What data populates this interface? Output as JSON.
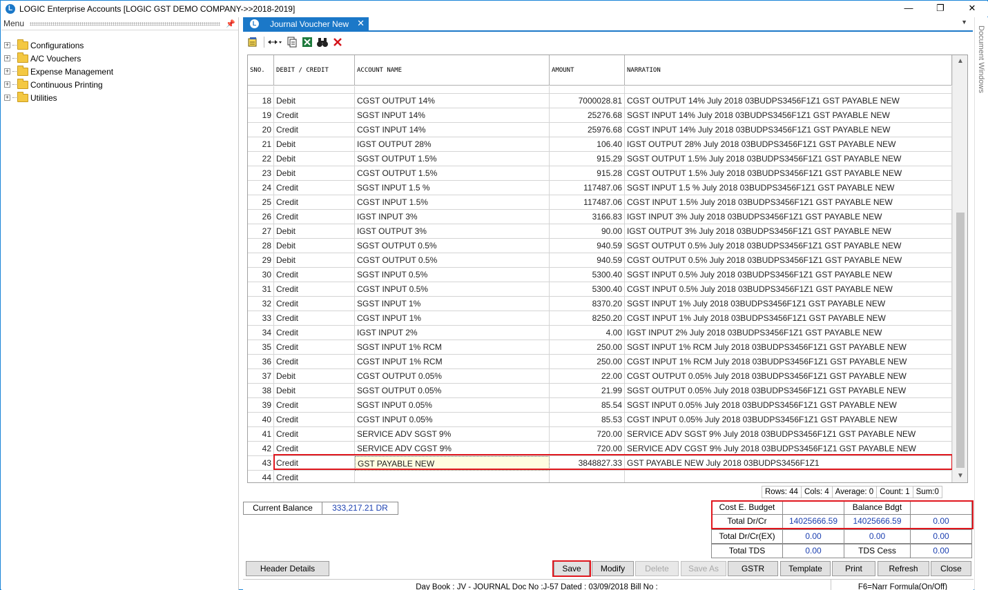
{
  "window": {
    "title": "LOGIC Enterprise Accounts  [LOGIC GST DEMO COMPANY->>2018-2019]",
    "minimize": "—",
    "restore": "❐",
    "close": "✕"
  },
  "menu": {
    "header": "Menu",
    "items": [
      {
        "label": "Configurations"
      },
      {
        "label": "A/C Vouchers"
      },
      {
        "label": "Expense Management"
      },
      {
        "label": "Continuous Printing"
      },
      {
        "label": "Utilities"
      }
    ]
  },
  "tab": {
    "label": "Journal Voucher New",
    "close": "✕"
  },
  "side_strip": "Document Windows",
  "grid": {
    "columns": [
      "SNO.",
      "DEBIT / CREDIT",
      "ACCOUNT NAME",
      "AMOUNT",
      "NARRATION"
    ],
    "rows": [
      {
        "sno": "18",
        "dc": "Debit",
        "account": "CGST OUTPUT 14%",
        "amount": "7000028.81",
        "narration": "CGST OUTPUT 14% July 2018 03BUDPS3456F1Z1 GST PAYABLE NEW"
      },
      {
        "sno": "19",
        "dc": "Credit",
        "account": "SGST INPUT 14%",
        "amount": "25276.68",
        "narration": "SGST INPUT  14% July 2018 03BUDPS3456F1Z1 GST PAYABLE NEW"
      },
      {
        "sno": "20",
        "dc": "Credit",
        "account": "CGST INPUT 14%",
        "amount": "25976.68",
        "narration": "CGST INPUT 14% July 2018 03BUDPS3456F1Z1 GST PAYABLE NEW"
      },
      {
        "sno": "21",
        "dc": "Debit",
        "account": "IGST OUTPUT 28%",
        "amount": "106.40",
        "narration": "IGST OUTPUT 28% July 2018 03BUDPS3456F1Z1 GST PAYABLE NEW"
      },
      {
        "sno": "22",
        "dc": "Debit",
        "account": "SGST OUTPUT 1.5%",
        "amount": "915.29",
        "narration": "SGST OUTPUT 1.5% July 2018 03BUDPS3456F1Z1 GST PAYABLE NEW"
      },
      {
        "sno": "23",
        "dc": "Debit",
        "account": "CGST OUTPUT 1.5%",
        "amount": "915.28",
        "narration": "CGST OUTPUT 1.5% July 2018 03BUDPS3456F1Z1 GST PAYABLE NEW"
      },
      {
        "sno": "24",
        "dc": "Credit",
        "account": "SGST INPUT 1.5 %",
        "amount": "117487.06",
        "narration": "SGST INPUT 1.5 % July 2018 03BUDPS3456F1Z1 GST PAYABLE NEW"
      },
      {
        "sno": "25",
        "dc": "Credit",
        "account": "CGST INPUT 1.5%",
        "amount": "117487.06",
        "narration": "CGST INPUT 1.5% July 2018 03BUDPS3456F1Z1 GST PAYABLE NEW"
      },
      {
        "sno": "26",
        "dc": "Credit",
        "account": "IGST INPUT 3%",
        "amount": "3166.83",
        "narration": "IGST INPUT 3% July 2018 03BUDPS3456F1Z1 GST PAYABLE NEW"
      },
      {
        "sno": "27",
        "dc": "Debit",
        "account": "IGST OUTPUT 3%",
        "amount": "90.00",
        "narration": "IGST OUTPUT 3% July 2018 03BUDPS3456F1Z1 GST PAYABLE NEW"
      },
      {
        "sno": "28",
        "dc": "Debit",
        "account": "SGST OUTPUT 0.5%",
        "amount": "940.59",
        "narration": "SGST OUTPUT 0.5% July 2018 03BUDPS3456F1Z1 GST PAYABLE NEW"
      },
      {
        "sno": "29",
        "dc": "Debit",
        "account": "CGST OUTPUT 0.5%",
        "amount": "940.59",
        "narration": "CGST OUTPUT 0.5% July 2018 03BUDPS3456F1Z1 GST PAYABLE NEW"
      },
      {
        "sno": "30",
        "dc": "Credit",
        "account": "SGST INPUT 0.5%",
        "amount": "5300.40",
        "narration": "SGST INPUT 0.5% July 2018 03BUDPS3456F1Z1 GST PAYABLE NEW"
      },
      {
        "sno": "31",
        "dc": "Credit",
        "account": "CGST INPUT 0.5%",
        "amount": "5300.40",
        "narration": "CGST INPUT 0.5% July 2018 03BUDPS3456F1Z1 GST PAYABLE NEW"
      },
      {
        "sno": "32",
        "dc": "Credit",
        "account": "SGST INPUT 1%",
        "amount": "8370.20",
        "narration": "SGST INPUT 1% July 2018 03BUDPS3456F1Z1 GST PAYABLE NEW"
      },
      {
        "sno": "33",
        "dc": "Credit",
        "account": "CGST INPUT 1%",
        "amount": "8250.20",
        "narration": "CGST INPUT 1% July 2018 03BUDPS3456F1Z1 GST PAYABLE NEW"
      },
      {
        "sno": "34",
        "dc": "Credit",
        "account": "IGST INPUT 2%",
        "amount": "4.00",
        "narration": "IGST INPUT 2% July 2018 03BUDPS3456F1Z1 GST PAYABLE NEW"
      },
      {
        "sno": "35",
        "dc": "Credit",
        "account": "SGST INPUT 1% RCM",
        "amount": "250.00",
        "narration": "SGST INPUT 1% RCM July 2018 03BUDPS3456F1Z1 GST PAYABLE NEW"
      },
      {
        "sno": "36",
        "dc": "Credit",
        "account": "CGST INPUT 1% RCM",
        "amount": "250.00",
        "narration": "CGST INPUT 1% RCM July 2018 03BUDPS3456F1Z1 GST PAYABLE NEW"
      },
      {
        "sno": "37",
        "dc": "Debit",
        "account": "CGST OUTPUT 0.05%",
        "amount": "22.00",
        "narration": "CGST OUTPUT 0.05% July 2018 03BUDPS3456F1Z1 GST PAYABLE NEW"
      },
      {
        "sno": "38",
        "dc": "Debit",
        "account": "SGST OUTPUT 0.05%",
        "amount": "21.99",
        "narration": "SGST OUTPUT 0.05% July 2018 03BUDPS3456F1Z1 GST PAYABLE NEW"
      },
      {
        "sno": "39",
        "dc": "Credit",
        "account": "SGST INPUT 0.05%",
        "amount": "85.54",
        "narration": "SGST INPUT 0.05% July 2018 03BUDPS3456F1Z1 GST PAYABLE NEW"
      },
      {
        "sno": "40",
        "dc": "Credit",
        "account": "CGST INPUT 0.05%",
        "amount": "85.53",
        "narration": "CGST INPUT 0.05% July 2018 03BUDPS3456F1Z1 GST PAYABLE NEW"
      },
      {
        "sno": "41",
        "dc": "Credit",
        "account": "SERVICE ADV SGST 9%",
        "amount": "720.00",
        "narration": "SERVICE ADV SGST 9% July 2018 03BUDPS3456F1Z1 GST PAYABLE NEW"
      },
      {
        "sno": "42",
        "dc": "Credit",
        "account": "SERVICE ADV CGST 9%",
        "amount": "720.00",
        "narration": "SERVICE ADV CGST 9% July 2018 03BUDPS3456F1Z1 GST PAYABLE NEW"
      },
      {
        "sno": "43",
        "dc": "Credit",
        "account": "GST PAYABLE NEW",
        "amount": "3848827.33",
        "narration": " GST PAYABLE NEW July 2018 03BUDPS3456F1Z1"
      },
      {
        "sno": "44",
        "dc": "Credit",
        "account": "",
        "amount": "",
        "narration": ""
      }
    ]
  },
  "status": {
    "rows": "Rows: 44",
    "cols": "Cols: 4",
    "average": "Average: 0",
    "count": "Count: 1",
    "sum": "Sum:0"
  },
  "current_balance": {
    "label": "Current Balance",
    "value": "333,217.21 DR"
  },
  "totals": {
    "cost_budget_label": "Cost E. Budget",
    "cost_budget_value": "",
    "balance_bdgt_label": "Balance Bdgt",
    "balance_bdgt_value": "",
    "total_drcr_label": "Total Dr/Cr",
    "total_drcr_dr": "14025666.59",
    "total_drcr_cr": "14025666.59",
    "total_drcr_diff": "0.00",
    "total_drcr_ex_label": "Total Dr/Cr(EX)",
    "total_drcr_ex_dr": "0.00",
    "total_drcr_ex_cr": "0.00",
    "total_drcr_ex_diff": "0.00",
    "total_tds_label": "Total TDS",
    "total_tds_value": "0.00",
    "tds_cess_label": "TDS Cess",
    "tds_cess_value": "0.00"
  },
  "buttons": {
    "header_details": "Header Details",
    "save": "Save",
    "modify": "Modify",
    "delete": "Delete",
    "save_as": "Save As",
    "gstr": "GSTR",
    "template": "Template",
    "print": "Print",
    "refresh": "Refresh",
    "close": "Close"
  },
  "bottom_bar": {
    "info": "Day Book : JV - JOURNAL  Doc No :J-57  Dated : 03/09/2018  Bill No :",
    "formula": "F6=Narr Formula(On/Off)"
  },
  "colors": {
    "accent": "#1b78c8",
    "highlight": "#e0161d",
    "value_blue": "#1a3fb0"
  },
  "icons": [
    "app-logo-icon",
    "new-voucher-icon",
    "column-resize-icon",
    "copy-icon",
    "excel-icon",
    "binoculars-icon",
    "delete-x-icon"
  ]
}
